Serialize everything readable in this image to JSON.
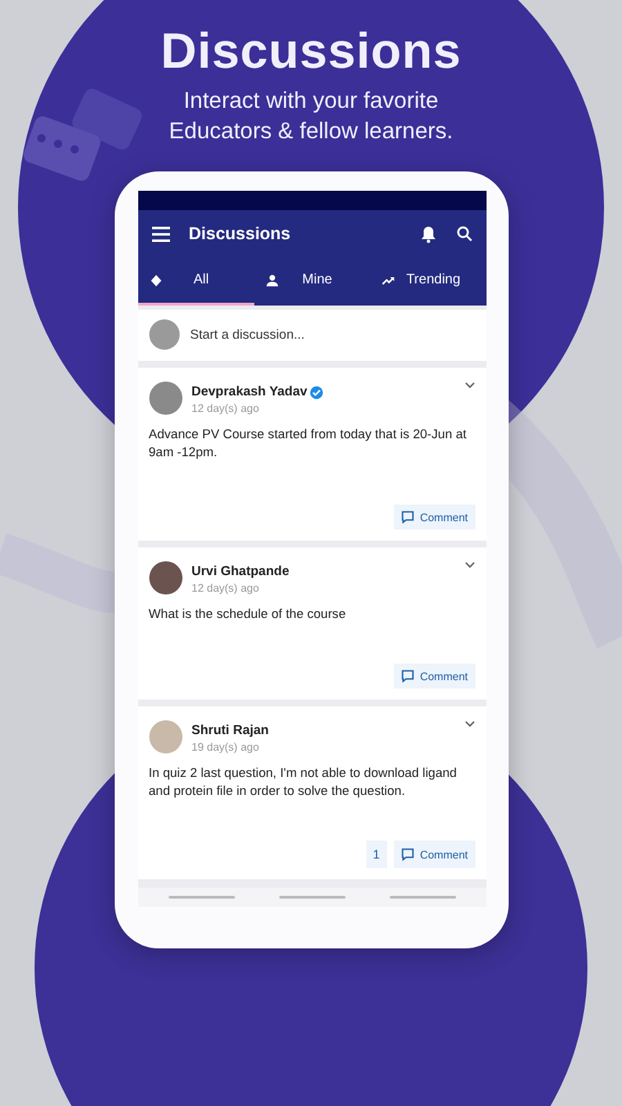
{
  "banner": {
    "title": "Discussions",
    "subtitle": "Interact with your favorite Educators & fellow learners."
  },
  "app_bar": {
    "title": "Discussions"
  },
  "tabs": [
    {
      "label": "All",
      "selected": true
    },
    {
      "label": "Mine",
      "selected": false
    },
    {
      "label": "Trending",
      "selected": false
    }
  ],
  "composer": {
    "placeholder": "Start a discussion..."
  },
  "posts": [
    {
      "author": "Devprakash Yadav",
      "verified": true,
      "time": "12 day(s) ago",
      "body": "Advance PV Course started from today that is 20-Jun at 9am -12pm.",
      "comment_label": "Comment"
    },
    {
      "author": "Urvi Ghatpande",
      "verified": false,
      "time": "12 day(s) ago",
      "body": "What is the schedule of the course",
      "comment_label": "Comment"
    },
    {
      "author": "Shruti Rajan",
      "verified": false,
      "time": "19 day(s) ago",
      "body": "In quiz 2 last question, I'm not able to download ligand and protein file in order to solve the question.",
      "replies": "1",
      "comment_label": "Comment"
    }
  ]
}
